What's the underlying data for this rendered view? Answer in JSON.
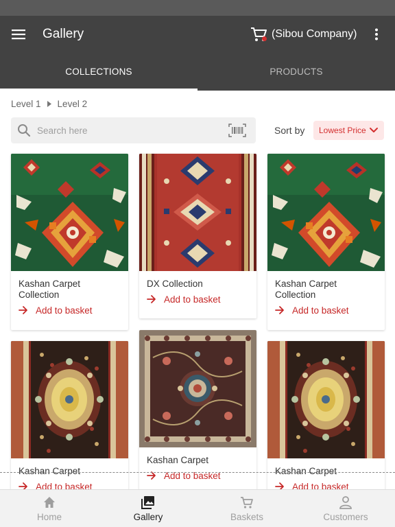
{
  "app_bar": {
    "title": "Gallery",
    "company": "(Sibou Company)",
    "menu_icon": "hamburger-menu-icon",
    "cart_icon": "shopping-cart-icon",
    "more_icon": "more-vert-icon"
  },
  "tabs": [
    {
      "label": "COLLECTIONS",
      "active": true
    },
    {
      "label": "PRODUCTS",
      "active": false
    }
  ],
  "breadcrumb": [
    "Level 1",
    "Level 2"
  ],
  "search": {
    "placeholder": "Search here",
    "value": ""
  },
  "sort": {
    "label": "Sort by",
    "value": "Lowest Price"
  },
  "cards": [
    {
      "title": "Kashan Carpet Collection",
      "action": "Add to basket",
      "image": "green-carpet"
    },
    {
      "title": "DX Collection",
      "action": "Add to basket",
      "image": "red-runner"
    },
    {
      "title": "Kashan Carpet Collection",
      "action": "Add to basket",
      "image": "green-carpet"
    },
    {
      "title": "Kashan Carpet",
      "action": "Add to basket",
      "image": "medallion-carpet"
    },
    {
      "title": "Kashan Carpet",
      "action": "Add to basket",
      "image": "floral-carpet"
    },
    {
      "title": "Kashan Carpet",
      "action": "Add to basket",
      "image": "medallion-carpet"
    }
  ],
  "bottom_nav": [
    {
      "label": "Home",
      "icon": "home-icon",
      "active": false
    },
    {
      "label": "Gallery",
      "icon": "gallery-icon",
      "active": true
    },
    {
      "label": "Baskets",
      "icon": "basket-icon",
      "active": false
    },
    {
      "label": "Customers",
      "icon": "person-icon",
      "active": false
    }
  ],
  "colors": {
    "app_bar": "#424242",
    "accent_red": "#d32f2f",
    "sort_bg": "#fde7e7"
  }
}
